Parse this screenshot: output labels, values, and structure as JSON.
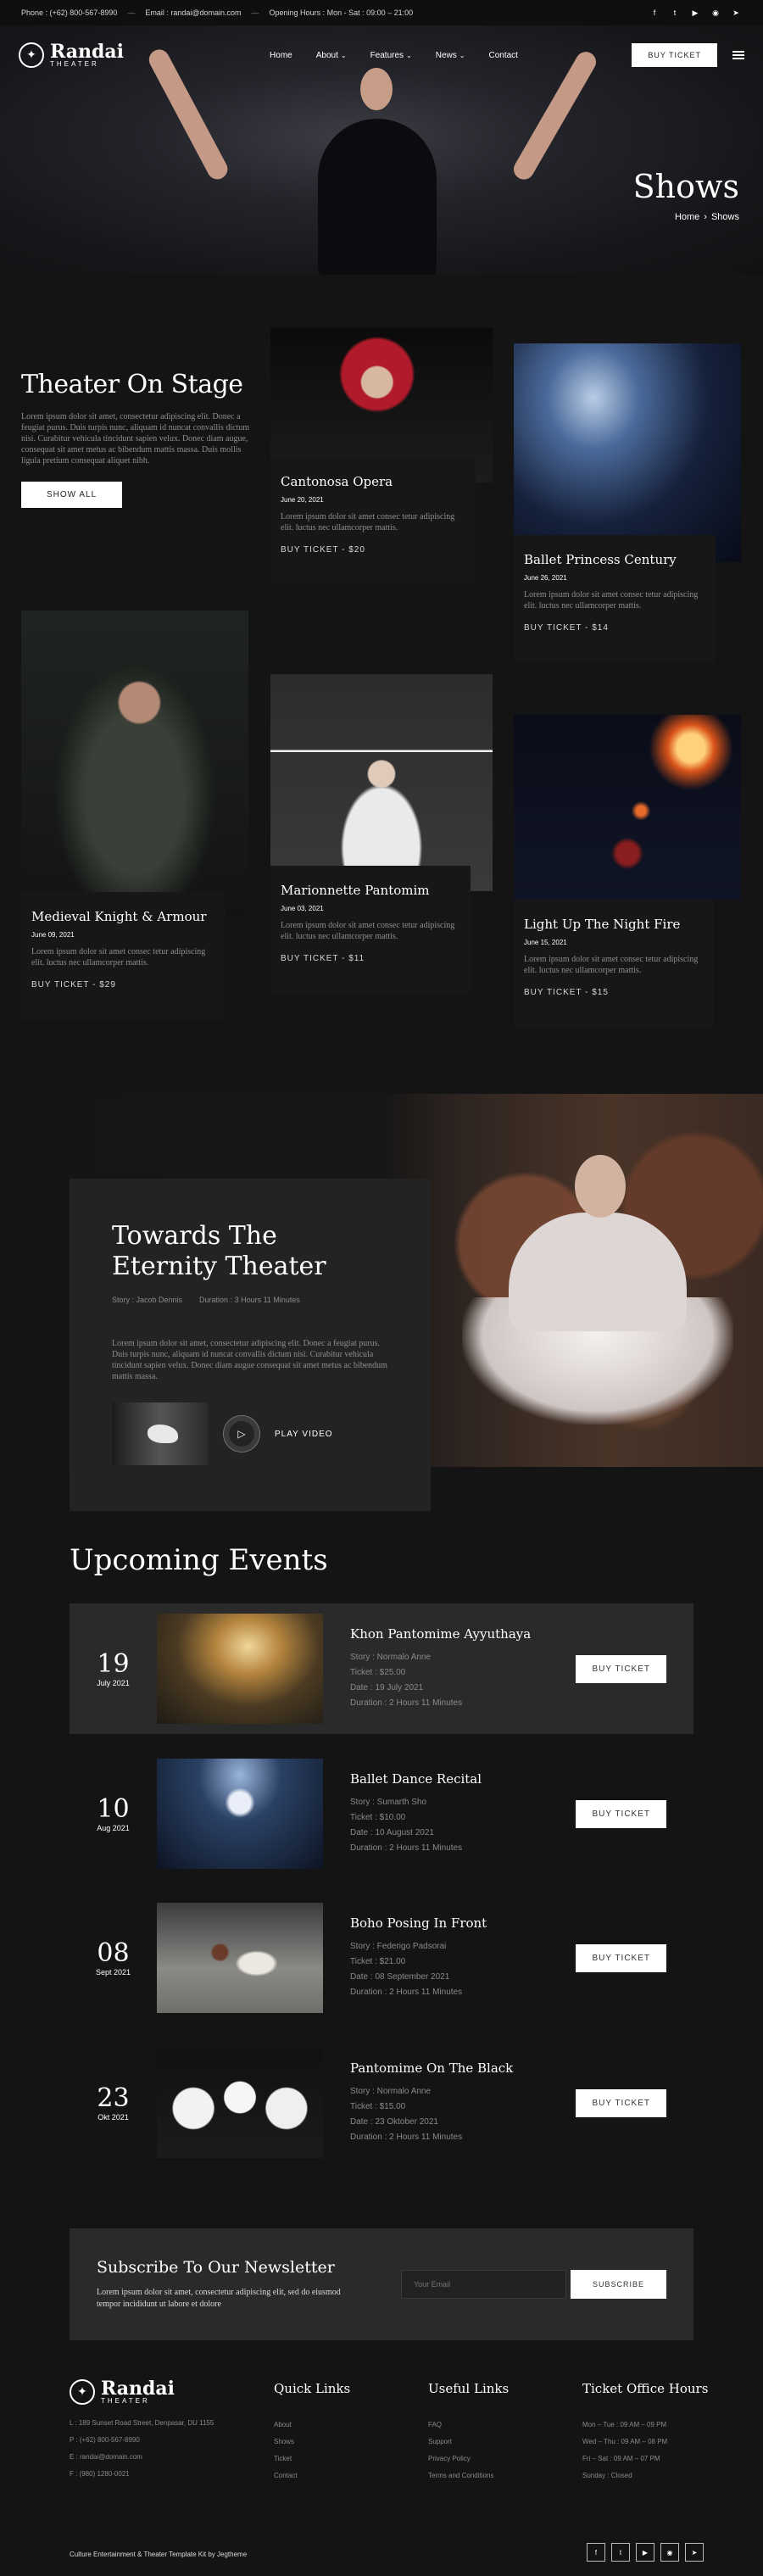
{
  "topbar": {
    "phone": "Phone : (+62) 800-567-8990",
    "email": "Email : randai@domain.com",
    "hours": "Opening Hours : Mon - Sat : 09:00 – 21:00",
    "social": [
      "f",
      "t",
      "▶",
      "◉",
      "➤"
    ]
  },
  "nav": {
    "logo_name": "Randai",
    "logo_sub": "THEATER",
    "items": [
      {
        "label": "Home",
        "chevron": ""
      },
      {
        "label": "About",
        "chevron": "⌄"
      },
      {
        "label": "Features",
        "chevron": "⌄"
      },
      {
        "label": "News",
        "chevron": "⌄"
      },
      {
        "label": "Contact",
        "chevron": ""
      }
    ],
    "buy_ticket": "BUY TICKET"
  },
  "hero": {
    "title": "Shows",
    "breadcrumb_home": "Home",
    "breadcrumb_sep": "›",
    "breadcrumb_current": "Shows"
  },
  "intro": {
    "title": "Theater On Stage",
    "text": "Lorem ipsum dolor sit amet, consectetur adipiscing elit. Donec a feugiat purus. Duis turpis nunc, aliquam id nuncat convallis dictum nisi. Curabitur vehicula tincidunt sapien velux. Donec diam augue, consequat sit amet metus ac bibendum mattis massa. Duis mollis ligula pretium consequat aliquet nibh.",
    "button": "SHOW ALL"
  },
  "shows": [
    {
      "title": "Cantonosa Opera",
      "date": "June 20, 2021",
      "desc": "Lorem ipsum dolor sit amet consec tetur adipiscing elit. luctus nec ullamcorper mattis.",
      "ticket": "BUY TICKET - $20"
    },
    {
      "title": "Ballet Princess Century",
      "date": "June 26, 2021",
      "desc": "Lorem ipsum dolor sit amet consec tetur adipiscing elit. luctus nec ullamcorper mattis.",
      "ticket": "BUY TICKET - $14"
    },
    {
      "title": "Medieval Knight & Armour",
      "date": "June 09, 2021",
      "desc": "Lorem ipsum dolor sit amet consec tetur adipiscing elit. luctus nec ullamcorper mattis.",
      "ticket": "BUY TICKET - $29"
    },
    {
      "title": "Marionnette Pantomim",
      "date": "June 03, 2021",
      "desc": "Lorem ipsum dolor sit amet consec tetur adipiscing elit. luctus nec ullamcorper mattis.",
      "ticket": "BUY TICKET - $11"
    },
    {
      "title": "Light Up The Night Fire",
      "date": "June 15, 2021",
      "desc": "Lorem ipsum dolor sit amet consec tetur adipiscing elit. luctus nec ullamcorper mattis.",
      "ticket": "BUY TICKET - $15"
    }
  ],
  "featured": {
    "title": "Towards The Eternity Theater",
    "story": "Story : Jacob Dennis",
    "duration": "Duration : 3 Hours 11 Minutes",
    "text": "Lorem ipsum dolor sit amet, consectetur adipiscing elit. Donec a feugiat purus. Duis turpis nunc, aliquam id nuncat convallis dictum nisi. Curabitur vehicula tincidunt sapien velux. Donec diam augue consequat sit amet metus ac bibendum mattis massa.",
    "play_label": "PLAY VIDEO"
  },
  "upcoming": {
    "title": "Upcoming Events",
    "events": [
      {
        "day": "19",
        "month": "July 2021",
        "title": "Khon Pantomime Ayyuthaya",
        "story": "Story : Normalo Anne",
        "ticket": "Ticket : $25.00",
        "date": "Date : 19 July 2021",
        "duration": "Duration : 2 Hours 11 Minutes",
        "button": "BUY TICKET"
      },
      {
        "day": "10",
        "month": "Aug 2021",
        "title": "Ballet Dance Recital",
        "story": "Story : Sumarth Sho",
        "ticket": "Ticket : $10.00",
        "date": "Date : 10 August 2021",
        "duration": "Duration : 2 Hours 11 Minutes",
        "button": "BUY TICKET"
      },
      {
        "day": "08",
        "month": "Sept 2021",
        "title": "Boho Posing In Front",
        "story": "Story : Federigo Padsorai",
        "ticket": "Ticket : $21.00",
        "date": "Date : 08 September 2021",
        "duration": "Duration : 2 Hours 11 Minutes",
        "button": "BUY TICKET"
      },
      {
        "day": "23",
        "month": "Okt 2021",
        "title": "Pantomime On The Black",
        "story": "Story : Normalo Anne",
        "ticket": "Ticket : $15.00",
        "date": "Date : 23 Oktober 2021",
        "duration": "Duration : 2 Hours 11 Minutes",
        "button": "BUY TICKET"
      }
    ]
  },
  "newsletter": {
    "title": "Subscribe To Our Newsletter",
    "text": "Lorem ipsum dolor sit amet, consectetur adipiscing elit, sed do eiusmod tempor incididunt ut labore et dolore",
    "placeholder": "Your Email",
    "button": "SUBSCRIBE"
  },
  "footer": {
    "logo_name": "Randai",
    "logo_sub": "THEATER",
    "address": "L : 189 Sunset Road Street, Denpasar, DU 1155",
    "phone": "P : (+62) 800-567-8990",
    "email": "E : randai@domain.com",
    "fax": "F : (980) 1280-0021",
    "quick_links_title": "Quick Links",
    "quick_links": [
      "About",
      "Shows",
      "Ticket",
      "Contact"
    ],
    "useful_links_title": "Useful Links",
    "useful_links": [
      "FAQ",
      "Support",
      "Privacy Policy",
      "Terms and Conditions"
    ],
    "hours_title": "Ticket Office Hours",
    "hours": [
      "Mon – Tue : 09 AM – 09 PM",
      "Wed – Thu : 09 AM – 08 PM",
      "Fri – Sat : 09 AM – 07 PM",
      "Sunday : Closed"
    ],
    "copyright": "Culture Entertainment & Theater Template Kit by Jegtheme",
    "social": [
      "f",
      "t",
      "▶",
      "◉",
      "➤"
    ]
  },
  "colors": {
    "background": "#141414",
    "card": "#2a2a2a",
    "accent": "#ffffff",
    "muted_text": "#8e8e8e"
  }
}
